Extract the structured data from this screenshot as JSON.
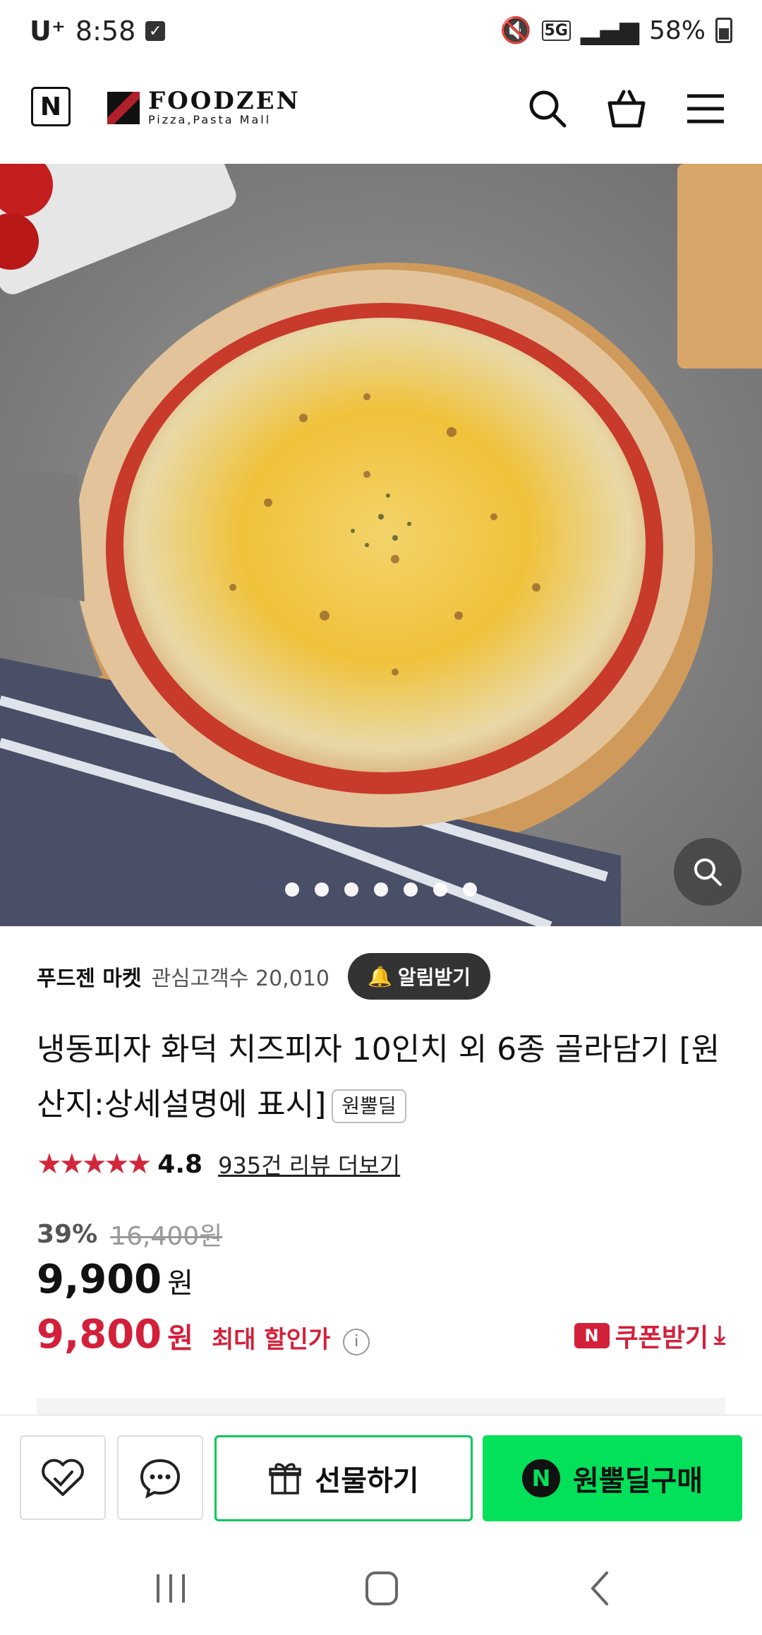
{
  "status_bar": {
    "carrier": "U⁺",
    "time": "8:58",
    "network": "5G",
    "battery": "58%"
  },
  "header": {
    "n_logo": "N",
    "brand_name": "FOODZEN",
    "brand_tagline": "Pizza,Pasta Mall"
  },
  "gallery": {
    "slide_count": 7
  },
  "store": {
    "name": "푸드젠 마켓",
    "subscribers": "관심고객수 20,010",
    "notify_label": "알림받기"
  },
  "product": {
    "title": "냉동피자 화덕 치즈피자 10인치 외 6종 골라담기 [원산지:상세설명에 표시]",
    "badge": "원뿔딜",
    "stars": "★★★★★",
    "rating": "4.8",
    "review_link": "935건 리뷰 더보기",
    "discount_pct": "39%",
    "original_price": "16,400원",
    "price_num": "9,900",
    "price_unit": "원",
    "max_price_num": "9,800",
    "max_price_unit": "원",
    "max_price_label": "최대 할인가",
    "info_icon": "i",
    "coupon_label": "쿠폰받기",
    "coupon_n": "N"
  },
  "bottom_bar": {
    "gift_label": "선물하기",
    "buy_label": "원뿔딜구매",
    "buy_n": "N"
  },
  "colors": {
    "accent_red": "#d3203a",
    "naver_green": "#03e05a"
  }
}
